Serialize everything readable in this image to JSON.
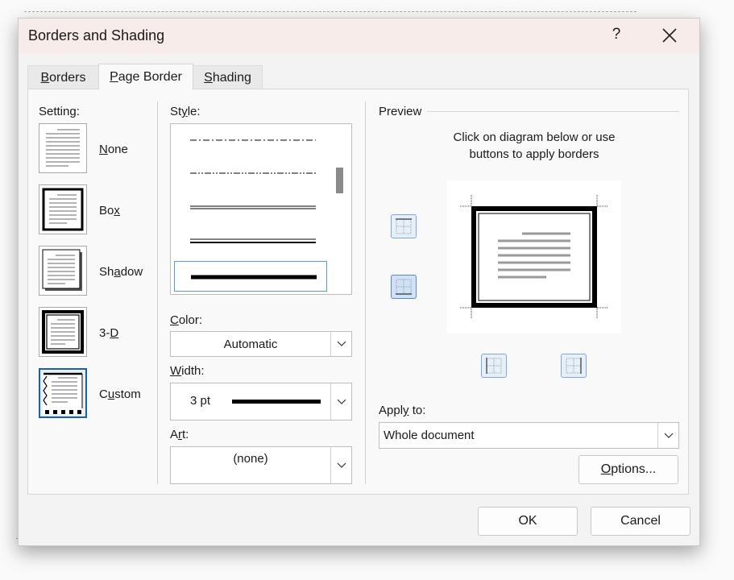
{
  "dialog": {
    "title": "Borders and Shading",
    "help_label": "?",
    "close_icon": "close-icon"
  },
  "tabs": [
    {
      "label": "Borders",
      "accesskey": "B",
      "rest": "orders",
      "active": false
    },
    {
      "label": "Page Border",
      "accesskey": "P",
      "rest": "age Border",
      "active": true
    },
    {
      "label": "Shading",
      "accesskey": "S",
      "rest": "hading",
      "active": false
    }
  ],
  "setting": {
    "label": "Setting:",
    "items": [
      {
        "pre": "",
        "key": "N",
        "post": "one",
        "label": "None",
        "icon": "setting-none-icon"
      },
      {
        "pre": "Bo",
        "key": "x",
        "post": "",
        "label": "Box",
        "icon": "setting-box-icon"
      },
      {
        "pre": "Sh",
        "key": "a",
        "post": "dow",
        "label": "Shadow",
        "icon": "setting-shadow-icon"
      },
      {
        "pre": "3-",
        "key": "D",
        "post": "",
        "label": "3-D",
        "icon": "setting-3d-icon"
      },
      {
        "pre": "C",
        "key": "u",
        "post": "stom",
        "label": "Custom",
        "icon": "setting-custom-icon",
        "selected": true
      }
    ]
  },
  "style": {
    "label_pre": "St",
    "label_key": "y",
    "label_post": "le:",
    "label": "Style:",
    "options": [
      "dash-dot",
      "dash-dot-dot",
      "double",
      "thin-thick",
      "thick"
    ],
    "selected": "thick"
  },
  "color": {
    "label_key": "C",
    "label_post": "olor:",
    "label": "Color:",
    "value": "Automatic"
  },
  "width": {
    "label_key": "W",
    "label_post": "idth:",
    "label": "Width:",
    "value": "3 pt"
  },
  "art": {
    "label_pre": "A",
    "label_key": "r",
    "label_post": "t:",
    "label": "Art:",
    "value": "(none)"
  },
  "preview": {
    "label": "Preview",
    "instruction_line1": "Click on diagram below or use",
    "instruction_line2": "buttons to apply borders",
    "buttons": [
      "top-border-icon",
      "bottom-border-icon",
      "left-border-icon",
      "right-border-icon"
    ]
  },
  "apply_to": {
    "label_pre": "Appl",
    "label_key": "y",
    "label_post": " to:",
    "label": "Apply to:",
    "value": "Whole document"
  },
  "buttons": {
    "options_key": "O",
    "options_rest": "ptions...",
    "options_label": "Options...",
    "ok_label": "OK",
    "cancel_label": "Cancel"
  },
  "colors": {
    "titlebar": "#f7ece9",
    "accent": "#1f5faa",
    "border_button": "#7ea6d6"
  }
}
